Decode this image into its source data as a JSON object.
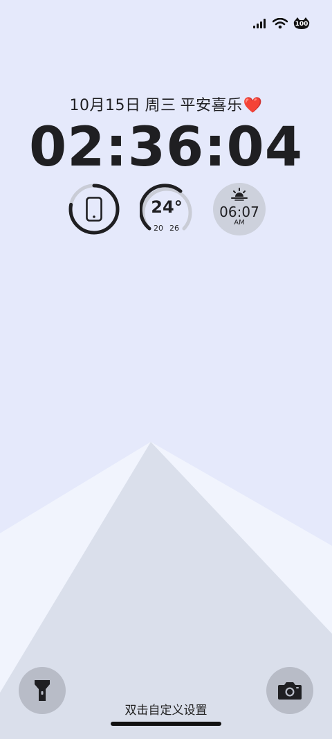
{
  "status_bar": {
    "icons": [
      "signal-icon",
      "wifi-icon",
      "battery-100-icon"
    ],
    "battery_level": "100"
  },
  "lockscreen": {
    "date": "10月15日",
    "weekday": "周三",
    "greeting": "平安喜乐",
    "greeting_emoji": "❤️",
    "time": "02:36:04"
  },
  "widgets": {
    "battery": {
      "icon": "phone-icon",
      "level_fraction": 0.78
    },
    "weather": {
      "temperature": "24°",
      "low": "20",
      "high": "26"
    },
    "sunrise": {
      "icon": "sunrise-icon",
      "time": "06:07",
      "period": "AM"
    }
  },
  "bottom": {
    "hint": "双击自定义设置",
    "left_shortcut_icon": "flashlight-icon",
    "right_shortcut_icon": "camera-icon"
  },
  "colors": {
    "background": "#e5e9fb",
    "mountain_front": "#dadfeb",
    "mountain_back": "#f1f4fd",
    "ring_active": "#1f1f22",
    "ring_track": "#c9ccd6",
    "button_bg": "#b8bcc7"
  }
}
